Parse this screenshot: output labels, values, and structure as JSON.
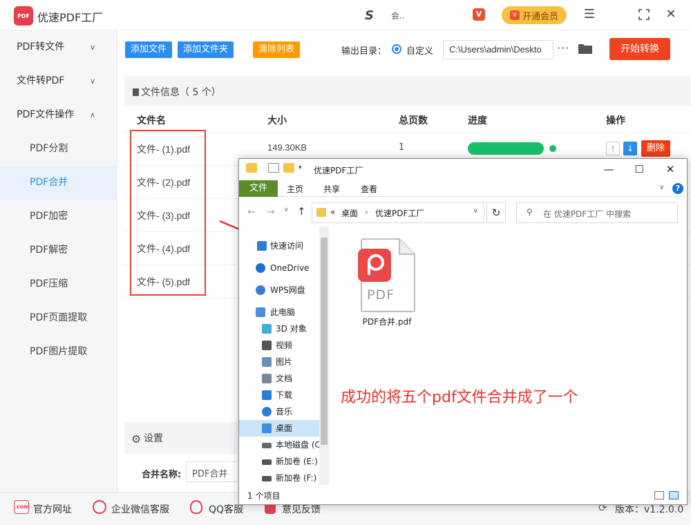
{
  "app": {
    "title": "优速PDF工厂",
    "logo_text": "PDF",
    "user_logo": "S",
    "user_name": "会..",
    "vip_icon": "V",
    "vip_label": "开通会员"
  },
  "window_controls": {
    "menu_icon": "☰",
    "max_icon": "⛶",
    "close_icon": "✕"
  },
  "sidebar": {
    "groups": [
      {
        "label": "PDF转文件",
        "chevron": "∨"
      },
      {
        "label": "文件转PDF",
        "chevron": "∨"
      },
      {
        "label": "PDF文件操作",
        "chevron": "∧"
      }
    ],
    "items": [
      {
        "label": "PDF分割",
        "active": false
      },
      {
        "label": "PDF合并",
        "active": true
      },
      {
        "label": "PDF加密",
        "active": false
      },
      {
        "label": "PDF解密",
        "active": false
      },
      {
        "label": "PDF压缩",
        "active": false
      },
      {
        "label": "PDF页面提取",
        "active": false
      },
      {
        "label": "PDF图片提取",
        "active": false
      }
    ]
  },
  "toolbar": {
    "add_file": "添加文件",
    "add_folder": "添加文件夹",
    "clear_list": "清除列表",
    "output_label": "输出目录：",
    "custom_label": "自定义",
    "output_path": "C:\\Users\\admin\\Deskto",
    "more": "···",
    "start": "开始转换",
    "colors": {
      "blue": "#2d8cf0",
      "orange": "#ff9900",
      "red": "#f0421e"
    }
  },
  "file_panel": {
    "title": "文件信息（ 5 个）",
    "columns": {
      "name": "文件名",
      "size": "大小",
      "pages": "总页数",
      "progress": "进度",
      "actions": "操作"
    },
    "rows": [
      {
        "name": "文件- (1).pdf",
        "size": "149.30KB",
        "pages": "1",
        "progress": 1.0
      },
      {
        "name": "文件- (2).pdf"
      },
      {
        "name": "文件- (3).pdf"
      },
      {
        "name": "文件- (4).pdf"
      },
      {
        "name": "文件- (5).pdf"
      }
    ],
    "move_up": "↑",
    "move_down": "↓",
    "delete": "删除"
  },
  "settings": {
    "title": "设置",
    "merge_label": "合并名称:",
    "merge_value": "PDF合并"
  },
  "footer": {
    "website": "官方网址",
    "wechat": "企业微信客服",
    "qq": "QQ客服",
    "feedback": "意见反馈",
    "version": "版本：v1.2.0.0",
    "website_icon": ".com"
  },
  "explorer": {
    "title": "优速PDF工厂",
    "ribbon": {
      "file": "文件",
      "home": "主页",
      "share": "共享",
      "view": "查看"
    },
    "address": {
      "prefix": "«",
      "part1": "桌面",
      "sep": "›",
      "part2": "优速PDF工厂"
    },
    "search_placeholder": "在 优速PDF工厂 中搜索",
    "nav": [
      {
        "label": "快速访问",
        "color": "#2d7cd6"
      },
      {
        "label": "OneDrive",
        "color": "#1f6fc5"
      },
      {
        "label": "WPS网盘",
        "color": "#3a7bd5"
      },
      {
        "label": "此电脑",
        "color": "#4a90d9"
      },
      {
        "label": "3D 对象",
        "color": "#3bb0d9"
      },
      {
        "label": "视频",
        "color": "#555555"
      },
      {
        "label": "图片",
        "color": "#6a8fb5"
      },
      {
        "label": "文档",
        "color": "#7a8a9a"
      },
      {
        "label": "下载",
        "color": "#2d7cd6"
      },
      {
        "label": "音乐",
        "color": "#2d7cd6"
      },
      {
        "label": "桌面",
        "color": "#3a8ee6",
        "selected": true
      },
      {
        "label": "本地磁盘 (C",
        "color": "#666666"
      },
      {
        "label": "新加卷 (E:)",
        "color": "#555555"
      },
      {
        "label": "新加卷 (F:)",
        "color": "#555555"
      }
    ],
    "file": {
      "name": "PDF合并.pdf",
      "badge": "PDF"
    },
    "status": "1 个项目"
  },
  "annotation": {
    "text": "成功的将五个pdf文件合并成了一个",
    "color": "#e8302e"
  }
}
